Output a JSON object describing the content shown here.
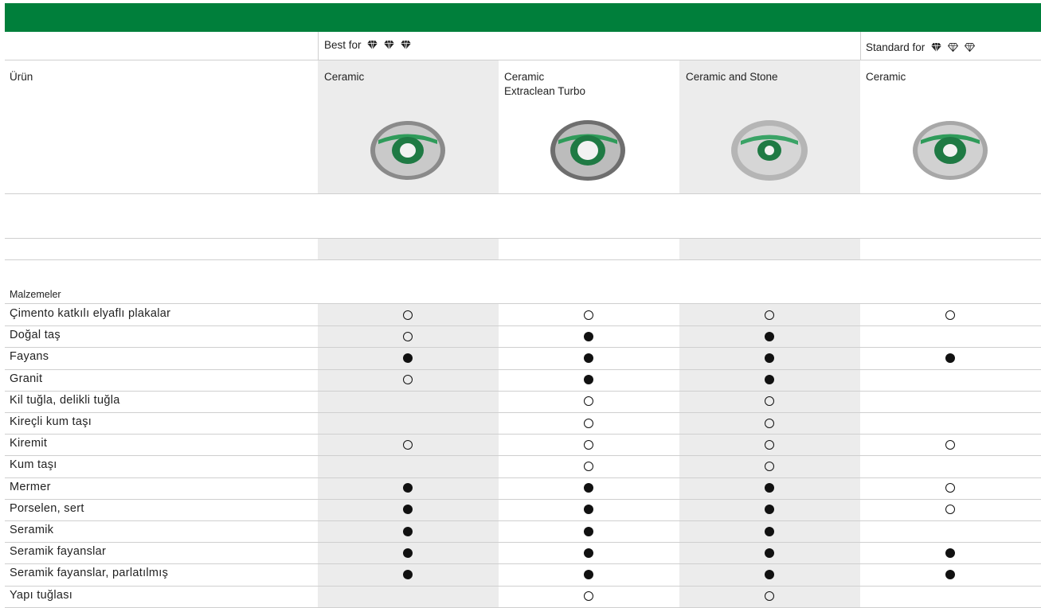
{
  "header": {
    "best_label": "Best for",
    "standard_label": "Standard for",
    "urun_label": "Ürün",
    "products": [
      "Ceramic",
      "Ceramic",
      "Ceramic and Stone",
      "Ceramic"
    ],
    "product2_line2": "Extraclean Turbo",
    "best_gems": [
      "filled",
      "filled",
      "filled"
    ],
    "standard_gems": [
      "filled",
      "outline",
      "outline"
    ]
  },
  "section_label": "Malzemeler",
  "materials": [
    {
      "name": "Çimento katkılı elyaflı plakalar",
      "marks": [
        "empty",
        "empty",
        "empty",
        "empty"
      ]
    },
    {
      "name": "Doğal taş",
      "marks": [
        "empty",
        "full",
        "full",
        ""
      ]
    },
    {
      "name": "Fayans",
      "marks": [
        "full",
        "full",
        "full",
        "full"
      ]
    },
    {
      "name": "Granit",
      "marks": [
        "empty",
        "full",
        "full",
        ""
      ]
    },
    {
      "name": "Kil tuğla, delikli tuğla",
      "marks": [
        "",
        "empty",
        "empty",
        ""
      ]
    },
    {
      "name": "Kireçli kum taşı",
      "marks": [
        "",
        "empty",
        "empty",
        ""
      ]
    },
    {
      "name": "Kiremit",
      "marks": [
        "empty",
        "empty",
        "empty",
        "empty"
      ]
    },
    {
      "name": "Kum taşı",
      "marks": [
        "",
        "empty",
        "empty",
        ""
      ]
    },
    {
      "name": "Mermer",
      "marks": [
        "full",
        "full",
        "full",
        "empty"
      ]
    },
    {
      "name": "Porselen, sert",
      "marks": [
        "full",
        "full",
        "full",
        "empty"
      ]
    },
    {
      "name": "Seramik",
      "marks": [
        "full",
        "full",
        "full",
        ""
      ]
    },
    {
      "name": "Seramik fayanslar",
      "marks": [
        "full",
        "full",
        "full",
        "full"
      ]
    },
    {
      "name": "Seramik fayanslar, parlatılmış",
      "marks": [
        "full",
        "full",
        "full",
        "full"
      ]
    },
    {
      "name": "Yapı tuğlası",
      "marks": [
        "",
        "empty",
        "empty",
        ""
      ]
    }
  ],
  "legend": {
    "full": "filled-circle",
    "empty": "open-circle"
  },
  "colors": {
    "brand_green": "#007f3b",
    "shade": "#ececec",
    "line": "#cfcfcf"
  }
}
